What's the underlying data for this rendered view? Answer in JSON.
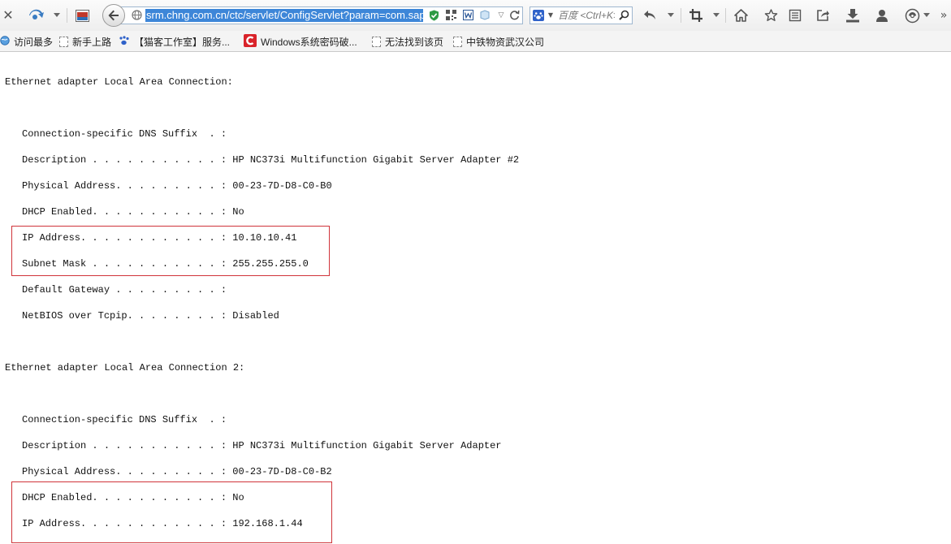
{
  "browser": {
    "address": "srm.chng.com.cn/ctc/servlet/ConfigServlet?param=com.sap",
    "search_placeholder": "百度 <Ctrl+K>"
  },
  "bookmarks": [
    {
      "label": "访问最多",
      "icon": "globe-icon"
    },
    {
      "label": "新手上路",
      "icon": "page-icon"
    },
    {
      "label": "【猫客工作室】服务...",
      "icon": "paw-icon"
    },
    {
      "label": "Windows系统密码破...",
      "icon": "red-c-icon"
    },
    {
      "label": "无法找到该页",
      "icon": "page-icon"
    },
    {
      "label": "中铁物资武汉公司",
      "icon": "page-icon"
    }
  ],
  "ipconfig": {
    "adapter1_header": "Ethernet adapter Local Area Connection:",
    "adapter1": [
      "Connection-specific DNS Suffix  . :",
      "Description . . . . . . . . . . . : HP NC373i Multifunction Gigabit Server Adapter #2",
      "Physical Address. . . . . . . . . : 00-23-7D-D8-C0-B0",
      "DHCP Enabled. . . . . . . . . . . : No",
      "IP Address. . . . . . . . . . . . : 10.10.10.41",
      "Subnet Mask . . . . . . . . . . . : 255.255.255.0",
      "Default Gateway . . . . . . . . . :",
      "NetBIOS over Tcpip. . . . . . . . : Disabled"
    ],
    "adapter2_header": "Ethernet adapter Local Area Connection 2:",
    "adapter2": [
      "Connection-specific DNS Suffix  . :",
      "Description . . . . . . . . . . . : HP NC373i Multifunction Gigabit Server Adapter",
      "Physical Address. . . . . . . . . : 00-23-7D-D8-C0-B2",
      "DHCP Enabled. . . . . . . . . . . : No",
      "IP Address. . . . . . . . . . . . : 192.168.1.44"
    ]
  },
  "colors": {
    "highlight_border": "#d0343a",
    "url_selection": "#3d86d8"
  }
}
